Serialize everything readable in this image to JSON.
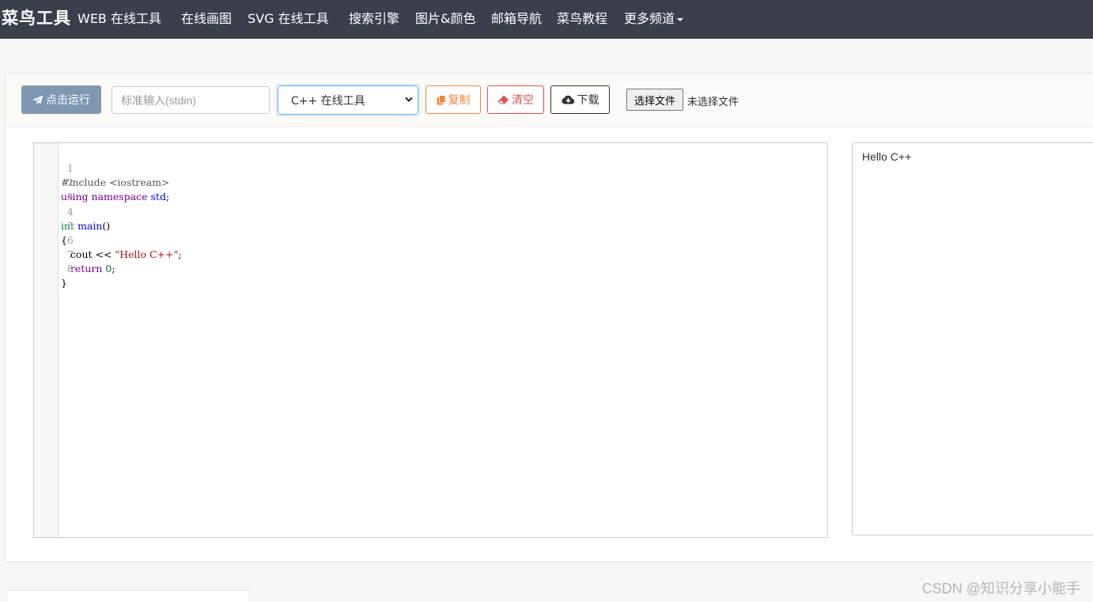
{
  "navbar": {
    "brand": "菜鸟工具",
    "items": [
      {
        "label": "WEB  在线工具"
      },
      {
        "label": "在线画图"
      },
      {
        "label": "SVG  在线工具"
      },
      {
        "label": "搜索引擎"
      },
      {
        "label": "图片&颜色"
      },
      {
        "label": "邮箱导航"
      },
      {
        "label": "菜鸟教程"
      },
      {
        "label": "更多频道"
      }
    ]
  },
  "toolbar": {
    "run_label": "点击运行",
    "stdin_placeholder": "标准输入(stdin)",
    "language_selected": "C++ 在线工具",
    "copy_label": "复制",
    "clear_label": "清空",
    "download_label": "下载",
    "choose_file_label": "选择文件",
    "file_status": "未选择文件"
  },
  "editor": {
    "line_numbers": [
      "1",
      "2",
      "3",
      "4",
      "5",
      "6",
      "7",
      "8"
    ]
  },
  "output": {
    "text": "Hello C++"
  },
  "watermark": "CSDN @知识分享小能手",
  "colors": {
    "navbar_bg": "#3a3f49",
    "run_button": "#7f98b1",
    "copy_accent": "#f0843a",
    "clear_accent": "#d9534f"
  },
  "icons": {
    "run": "paper-plane-icon",
    "copy": "copy-icon",
    "clear": "eraser-icon",
    "download": "cloud-download-icon",
    "select": "chevron-down-icon"
  }
}
